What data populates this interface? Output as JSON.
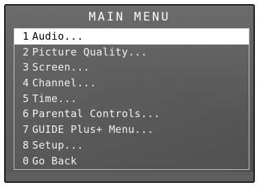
{
  "title": "MAIN MENU",
  "menu": {
    "items": [
      {
        "num": "1",
        "label": "Audio...",
        "selected": true
      },
      {
        "num": "2",
        "label": "Picture Quality...",
        "selected": false
      },
      {
        "num": "3",
        "label": "Screen...",
        "selected": false
      },
      {
        "num": "4",
        "label": "Channel...",
        "selected": false
      },
      {
        "num": "5",
        "label": "Time...",
        "selected": false
      },
      {
        "num": "6",
        "label": "Parental Controls...",
        "selected": false
      },
      {
        "num": "7",
        "label": "GUIDE Plus+ Menu...",
        "selected": false
      },
      {
        "num": "8",
        "label": "Setup...",
        "selected": false
      },
      {
        "num": "0",
        "label": "Go Back",
        "selected": false
      }
    ]
  },
  "colors": {
    "background": "#5a5a5a",
    "text": "#ffffff",
    "highlight": "#ffffff",
    "highlight_text": "#000000"
  }
}
